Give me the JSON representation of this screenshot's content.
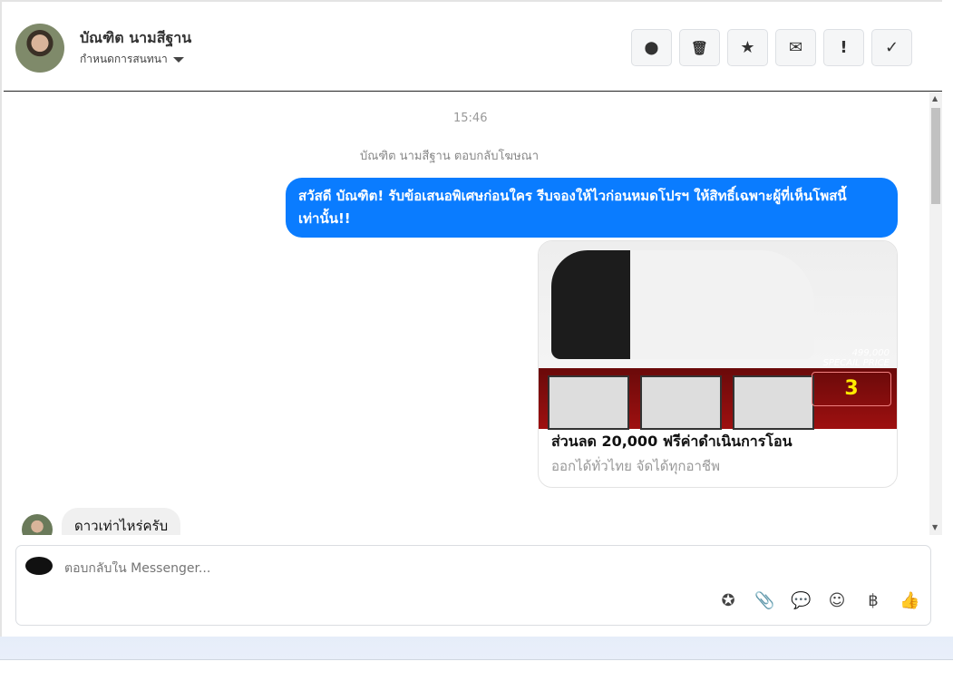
{
  "header": {
    "name": "บัณฑิต นามสีฐาน",
    "subtitle": "กำหนดการสนทนา",
    "actions": [
      {
        "icon": "alert-octagon-icon",
        "glyph": "⬤"
      },
      {
        "icon": "trash-icon",
        "glyph": "🗑"
      },
      {
        "icon": "star-icon",
        "glyph": "★"
      },
      {
        "icon": "mail-open-icon",
        "glyph": "✉"
      },
      {
        "icon": "exclamation-icon",
        "glyph": "!"
      },
      {
        "icon": "check-icon",
        "glyph": "✓"
      }
    ]
  },
  "chat": {
    "timestamp": "15:46",
    "ad_reply_note": "บัณฑิต นามสีฐาน ตอบกลับโฆษณา",
    "outgoing_message": "สวัสดี บัณฑิต! รับข้อเสนอพิเศษก่อนใคร รีบจองให้ไวก่อนหมดโปรฯ ให้สิทธิ์เฉพาะผู้ที่เห็นโพสนี้เท่านั้น!!",
    "card": {
      "title": "ส่วนลด 20,000 ฟรีค่าดำเนินการโอน",
      "subtitle": "ออกได้ทั่วไทย จัดได้ทุกอาชีพ",
      "image_price": "499,000",
      "image_price_label": "SPECAIL PRICE",
      "image_promo": "3"
    },
    "incoming_message": "ดาวเท่าไหร่ครับ"
  },
  "composer": {
    "placeholder": "ตอบกลับใน Messenger...",
    "tools": [
      {
        "icon": "saved-reply-icon",
        "glyph": "✪"
      },
      {
        "icon": "attachment-icon",
        "glyph": "📎"
      },
      {
        "icon": "chat-bubble-icon",
        "glyph": "💬"
      },
      {
        "icon": "emoji-icon",
        "glyph": "☺"
      },
      {
        "icon": "baht-icon",
        "glyph": "฿"
      },
      {
        "icon": "thumbs-up-icon",
        "glyph": "👍"
      }
    ]
  },
  "colors": {
    "accent": "#0a7cff"
  }
}
